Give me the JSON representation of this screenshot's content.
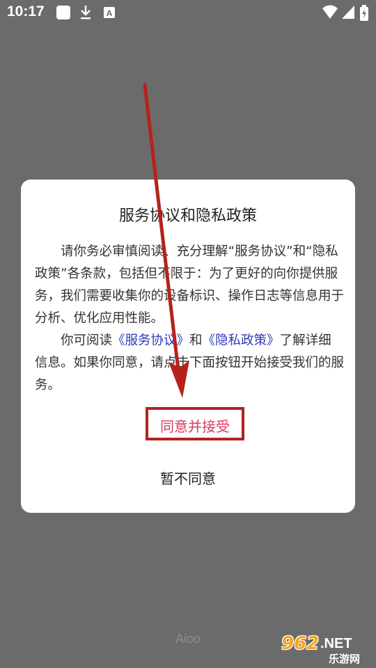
{
  "status_bar": {
    "time": "10:17",
    "icons": [
      "app-square-icon",
      "download-icon",
      "font-a-icon",
      "wifi-icon",
      "signal-icon",
      "battery-icon"
    ]
  },
  "dialog": {
    "title": "服务协议和隐私政策",
    "para1": "请你务必审慎阅读、充分理解“服务协议”和“隐私政策”各条款，包括但不限于：为了更好的向你提供服务，我们需要收集你的设备标识、操作日志等信息用于分析、优化应用性能。",
    "para2_prefix": "你可阅读",
    "link_service": "《服务协议》",
    "para2_and": "和",
    "link_privacy": "《隐私政策》",
    "para2_suffix": "了解详细信息。如果你同意，请点击下面按钮开始接受我们的服务。",
    "accept_label": "同意并接受",
    "decline_label": "暂不同意"
  },
  "footer": {
    "app_name": "Aioo"
  },
  "watermark": {
    "logo_text": "962",
    "net_text": ".NET",
    "cn_text": "乐游网"
  },
  "colors": {
    "overlay": "#6b6b6b",
    "link": "#2f3cb8",
    "accept_text": "#d83c5c",
    "annotation_red": "#b5221d"
  }
}
